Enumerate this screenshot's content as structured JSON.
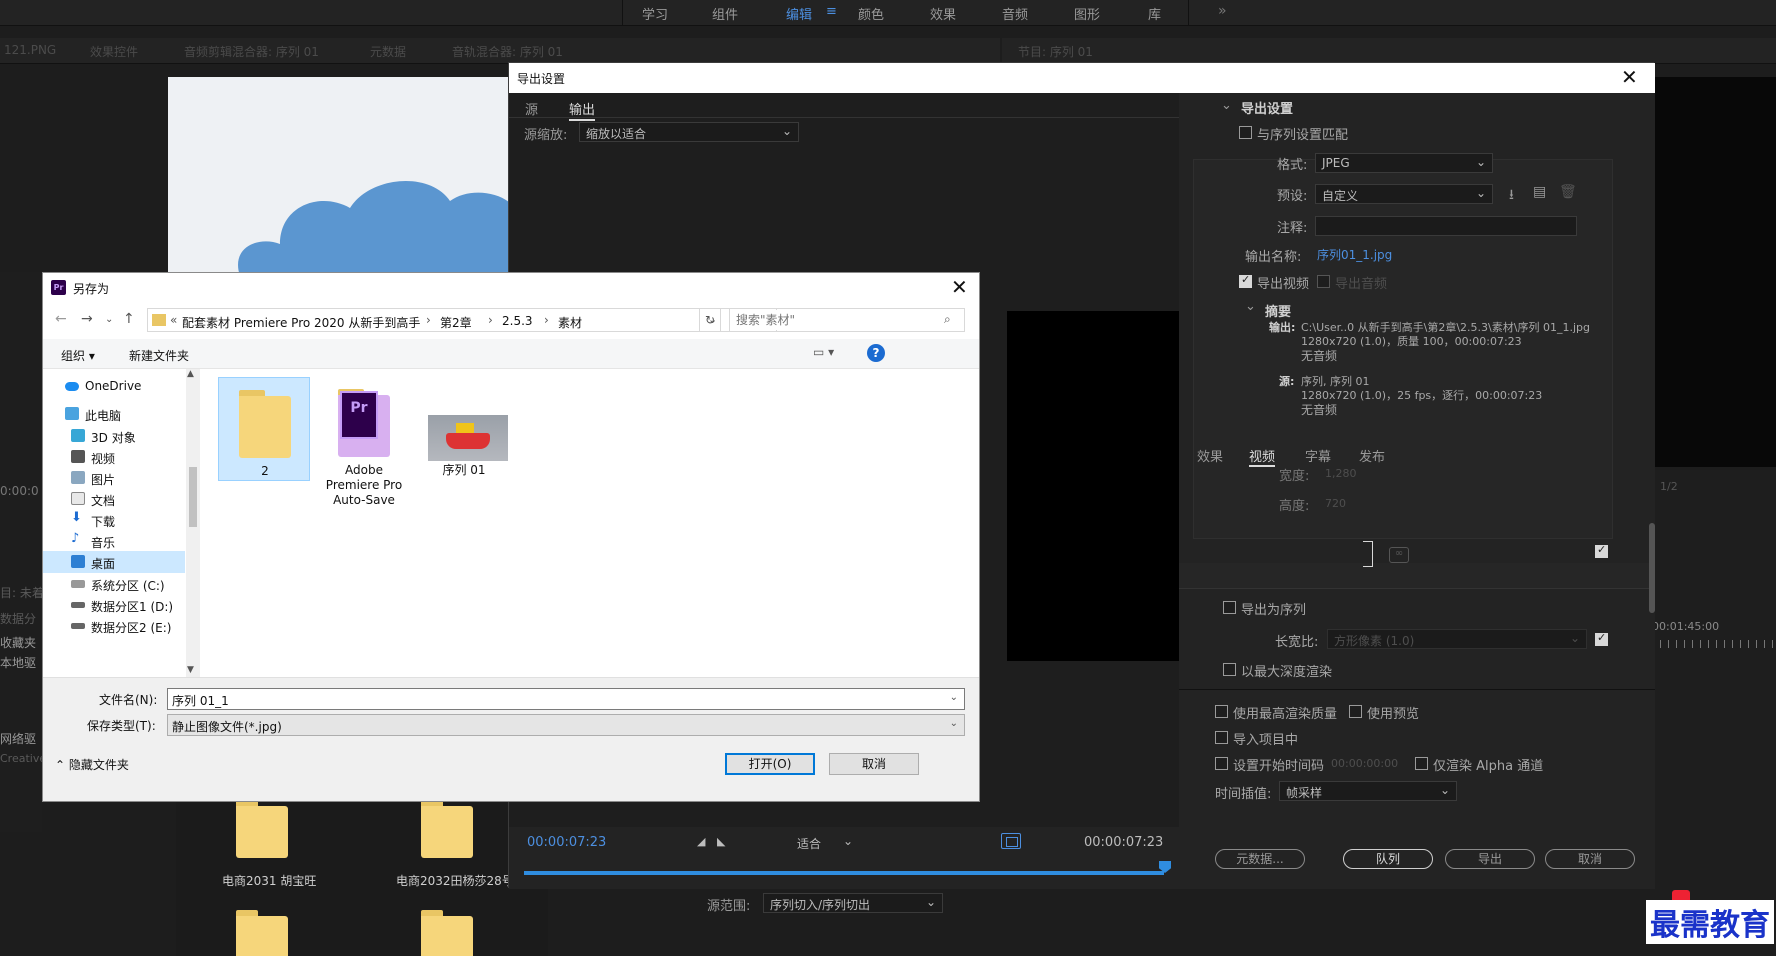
{
  "workspace": {
    "items": [
      "学习",
      "组件",
      "编辑",
      "颜色",
      "效果",
      "音频",
      "图形",
      "库"
    ],
    "active": "编辑",
    "menu_icon": "≡",
    "more": "»"
  },
  "panels": {
    "left_file_tab": "121.PNG",
    "tabs": [
      "效果控件",
      "音频剪辑混合器: 序列 01",
      "元数据",
      "音轨混合器: 序列 01"
    ],
    "program_tab": "节目: 序列 01",
    "left_timecode": "0:00:0",
    "left_side_labels": [
      "目: 未着",
      "数据分",
      "收藏夹",
      "本地驱",
      "网络驱",
      "Creative"
    ],
    "right_timecode": "00:01:45:00",
    "right_zoom": "1/2",
    "project_items": [
      "电商2031 胡宝旺",
      "电商2032田杨莎28号"
    ]
  },
  "export_dialog": {
    "title": "导出设置",
    "close": "✕",
    "tabs": [
      "源",
      "输出"
    ],
    "active_tab": "输出",
    "source_scale_label": "源缩放:",
    "source_scale_value": "缩放以适合",
    "timecode_in": "00:00:07:23",
    "timecode_out": "00:00:07:23",
    "fit_value": "适合",
    "range_label": "源范围:",
    "range_value": "序列切入/序列切出",
    "settings": {
      "header": "导出设置",
      "match_sequence": "与序列设置匹配",
      "format_label": "格式:",
      "format_value": "JPEG",
      "preset_label": "预设:",
      "preset_value": "自定义",
      "comment_label": "注释:",
      "output_name_label": "输出名称:",
      "output_name_value": "序列01_1.jpg",
      "export_video": "导出视频",
      "export_audio": "导出音频",
      "summary_header": "摘要",
      "output_key": "输出:",
      "output_lines": [
        "C:\\User..0 从新手到高手\\第2章\\2.5.3\\素材\\序列 01_1.jpg",
        "1280x720 (1.0)，质量 100，00:00:07:23",
        "无音频"
      ],
      "source_key": "源:",
      "source_lines": [
        "序列, 序列 01",
        "1280x720 (1.0)，25 fps，逐行，00:00:07:23",
        "无音频"
      ]
    },
    "lower_tabs": [
      "效果",
      "视频",
      "字幕",
      "发布"
    ],
    "lower_active": "视频",
    "video": {
      "width_label": "宽度:",
      "width_value": "1,280",
      "height_label": "高度:",
      "height_value": "720",
      "export_as_sequence": "导出为序列",
      "aspect_label": "长宽比:",
      "aspect_value": "方形像素 (1.0)",
      "max_depth": "以最大深度渲染"
    },
    "options": {
      "max_quality": "使用最高渲染质量",
      "use_previews": "使用预览",
      "import_project": "导入项目中",
      "set_start_tc": "设置开始时间码",
      "start_tc_value": "00:00:00:00",
      "render_alpha": "仅渲染 Alpha 通道",
      "interp_label": "时间插值:",
      "interp_value": "帧采样"
    },
    "buttons": {
      "metadata": "元数据...",
      "queue": "队列",
      "export": "导出",
      "cancel": "取消"
    }
  },
  "save_as": {
    "title": "另存为",
    "pr_badge": "Pr",
    "close": "✕",
    "breadcrumb": [
      "配套素材 Premiere Pro 2020 从新手到高手",
      "第2章",
      "2.5.3",
      "素材"
    ],
    "search_placeholder": "搜索\"素材\"",
    "organize": "组织 ▾",
    "new_folder": "新建文件夹",
    "help": "?",
    "nav_items": [
      "OneDrive",
      "此电脑",
      "3D 对象",
      "视频",
      "图片",
      "文档",
      "下载",
      "音乐",
      "桌面",
      "系统分区 (C:)",
      "数据分区1 (D:)",
      "数据分区2 (E:)"
    ],
    "nav_selected": "桌面",
    "files": [
      {
        "name": "2",
        "type": "folder"
      },
      {
        "name": "Adobe Premiere Pro Auto-Save",
        "type": "pr-folder"
      },
      {
        "name": "序列 01",
        "type": "image"
      }
    ],
    "filename_label": "文件名(N):",
    "filename_value": "序列 01_1",
    "filetype_label": "保存类型(T):",
    "filetype_value": "静止图像文件(*.jpg)",
    "hide_folders": "隐藏文件夹",
    "open_btn": "打开(O)",
    "cancel_btn": "取消"
  },
  "watermark": "最需教育"
}
